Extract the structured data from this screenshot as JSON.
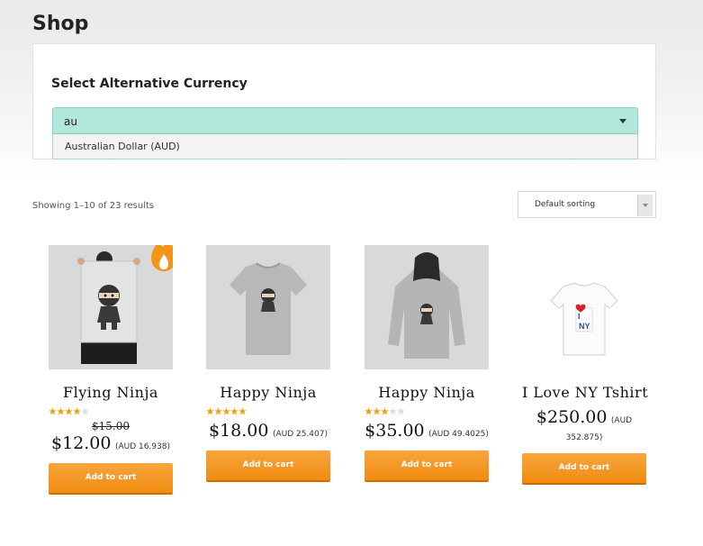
{
  "page": {
    "title": "Shop"
  },
  "currency": {
    "label": "Select Alternative Currency",
    "input_value": "au",
    "option": "Australian Dollar (AUD)"
  },
  "toolbar": {
    "result_count": "Showing 1–10 of 23 results",
    "sorting_label": "Default sorting"
  },
  "products": [
    {
      "name": "Flying Ninja",
      "rating": 4,
      "old_price": "$15.00",
      "price": "$12.00",
      "alt_price": "(AUD 16.938)",
      "button": "Add to cart",
      "badge": "fire-icon"
    },
    {
      "name": "Happy Ninja",
      "rating": 5,
      "price": "$18.00",
      "alt_price": "(AUD 25.407)",
      "button": "Add to cart"
    },
    {
      "name": "Happy Ninja",
      "rating": 3,
      "price": "$35.00",
      "alt_price": "(AUD 49.4025)",
      "button": "Add to cart"
    },
    {
      "name": "I Love NY Tshirt",
      "price": "$250.00",
      "alt_price": "(AUD 352.875)",
      "button": "Add to cart"
    }
  ],
  "colors": {
    "accent": "#f39518",
    "select_bg": "#b2e7db",
    "star": "#f0a30a"
  }
}
